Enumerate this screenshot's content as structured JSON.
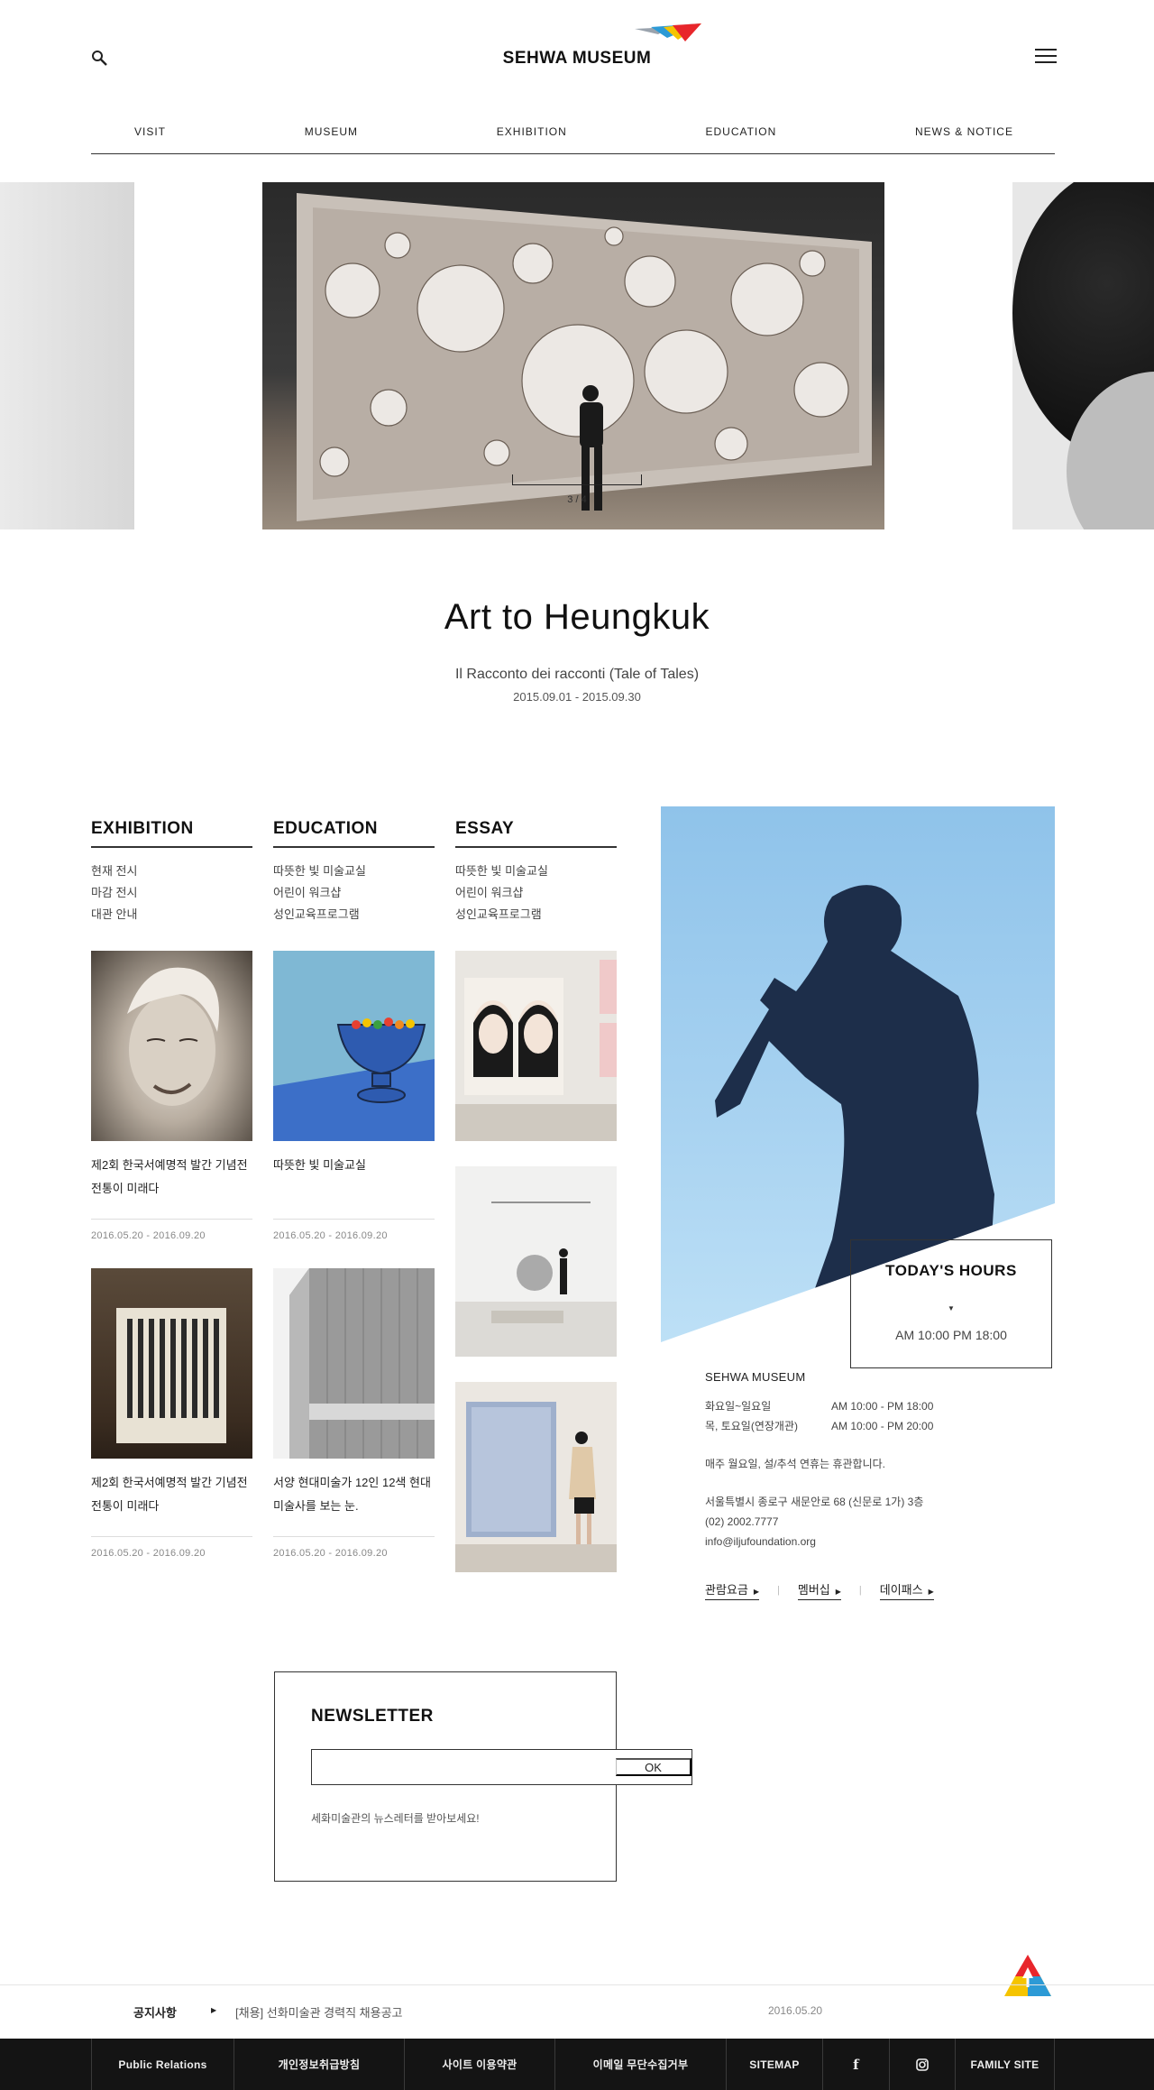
{
  "header": {
    "logo": "SEHWA MUSEUM",
    "nav": [
      "VISIT",
      "MUSEUM",
      "EXHIBITION",
      "EDUCATION",
      "NEWS & NOTICE"
    ]
  },
  "hero": {
    "counter": "3 / 4",
    "title": "Art to Heungkuk",
    "subtitle": "Il Racconto dei racconti (Tale of Tales)",
    "date": "2015.09.01 - 2015.09.30"
  },
  "columns": [
    {
      "heading": "EXHIBITION",
      "links": [
        "현재 전시",
        "마감 전시",
        "대관 안내"
      ],
      "cards": [
        {
          "title": "제2회 한국서예명적 발간 기념전 전통이 미래다",
          "date": "2016.05.20 - 2016.09.20"
        },
        {
          "title": "제2회 한국서예명적 발간 기념전 전통이 미래다",
          "date": "2016.05.20 - 2016.09.20"
        }
      ]
    },
    {
      "heading": "EDUCATION",
      "links": [
        "따뜻한 빛 미술교실",
        "어린이 워크샵",
        "성인교육프로그램"
      ],
      "cards": [
        {
          "title": "따뜻한 빛 미술교실",
          "date": "2016.05.20 - 2016.09.20"
        },
        {
          "title": "서양 현대미술가 12인 12색 현대미술사를 보는 눈.",
          "date": "2016.05.20 - 2016.09.20"
        }
      ]
    },
    {
      "heading": "ESSAY",
      "links": [
        "따뜻한 빛 미술교실",
        "어린이 워크샵",
        "성인교육프로그램"
      ]
    }
  ],
  "hours": {
    "title": "TODAY'S HOURS",
    "time": "AM 10:00 PM 18:00"
  },
  "info": {
    "name": "SEHWA MUSEUM",
    "rows": [
      {
        "day": "화요일~일요일",
        "time": "AM 10:00 - PM 18:00"
      },
      {
        "day": "목, 토요일(연장개관)",
        "time": "AM 10:00 - PM 20:00"
      }
    ],
    "closed": "매주 월요일, 설/추석 연휴는 휴관합니다.",
    "address": "서울특별시 종로구 새문안로 68 (신문로 1가) 3층",
    "phone": "(02) 2002.7777",
    "email": "info@iljufoundation.org",
    "links": [
      "관람요금",
      "멤버십",
      "데이패스"
    ]
  },
  "newsletter": {
    "title": "NEWSLETTER",
    "placeholder": "",
    "button": "OK",
    "desc": "세화미술관의 뉴스레터를 받아보세요!"
  },
  "notice": {
    "label": "공지사항",
    "text": "[채용] 선화미술관 경력직 채용공고",
    "date": "2016.05.20"
  },
  "footer": {
    "links": [
      "Public Relations",
      "개인정보취급방침",
      "사이트 이용약관",
      "이메일 무단수집거부",
      "SITEMAP",
      "FAMILY SITE"
    ]
  },
  "colors": {
    "accent_red": "#e8262b",
    "accent_yellow": "#f5c400",
    "accent_blue": "#2c9ad6",
    "footer_bg": "#141414"
  }
}
